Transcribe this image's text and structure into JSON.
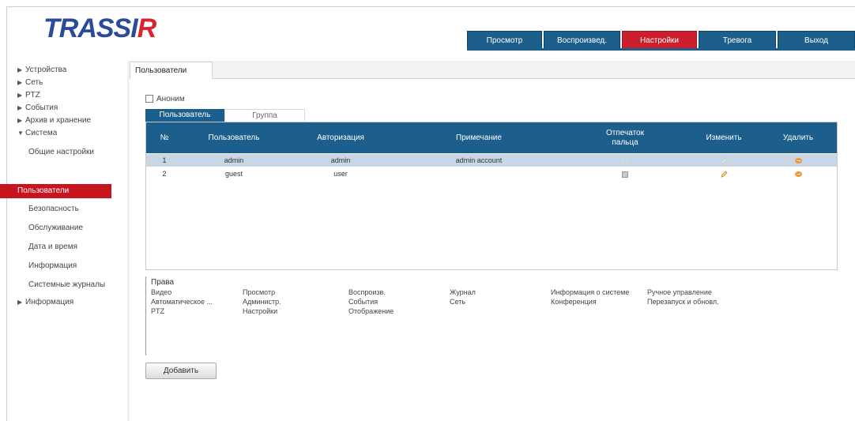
{
  "app": {
    "logo_main": "TRASSI",
    "logo_accent": "R"
  },
  "topnav": [
    {
      "label": "Просмотр"
    },
    {
      "label": "Воспроизвед."
    },
    {
      "label": "Настройки"
    },
    {
      "label": "Тревога"
    },
    {
      "label": "Выход"
    }
  ],
  "sidebar": {
    "items": [
      {
        "label": "Устройства"
      },
      {
        "label": "Сеть"
      },
      {
        "label": "PTZ"
      },
      {
        "label": "События"
      },
      {
        "label": "Архив и хранение"
      },
      {
        "label": "Система"
      }
    ],
    "subitems": [
      {
        "label": "Общие настройки"
      },
      {
        "label": "Пользователи"
      },
      {
        "label": "Безопасность"
      },
      {
        "label": "Обслуживание"
      },
      {
        "label": "Дата и время"
      },
      {
        "label": "Информация"
      },
      {
        "label": "Системные журналы"
      }
    ],
    "last": {
      "label": "Информация"
    }
  },
  "panel": {
    "tab_label": "Пользователи"
  },
  "anon_checkbox": {
    "label": "Аноним"
  },
  "subtabs": {
    "active": "Пользователь",
    "inactive": "Группа"
  },
  "table": {
    "headers": [
      "№",
      "Пользователь",
      "Авторизация",
      "Примечание",
      "Отпечаток\nпальца",
      "Изменить",
      "Удалить"
    ],
    "rows": [
      {
        "num": "1",
        "user": "admin",
        "auth": "admin",
        "note": "admin account"
      },
      {
        "num": "2",
        "user": "guest",
        "auth": "user",
        "note": ""
      }
    ]
  },
  "rights": {
    "title": "Права",
    "col1": [
      "Видео",
      "Автоматическое ...",
      "PTZ"
    ],
    "col2": [
      "Просмотр",
      "Администр.",
      "Настройки"
    ],
    "col3": [
      "Воспроизв.",
      "События",
      "Отображение"
    ],
    "col4": [
      "Журнал",
      "Сеть"
    ],
    "col5": [
      "Информация о системе",
      "Конференция"
    ],
    "col6": [
      "Ручное управление",
      "Перезапуск и обновл."
    ]
  },
  "add_button": {
    "label": "Добавить"
  },
  "colors": {
    "nav_blue": "#1d5f8c",
    "nav_red": "#cc1f2d",
    "row_selected": "#c9d6e6",
    "delete_orange": "#f0972f"
  }
}
